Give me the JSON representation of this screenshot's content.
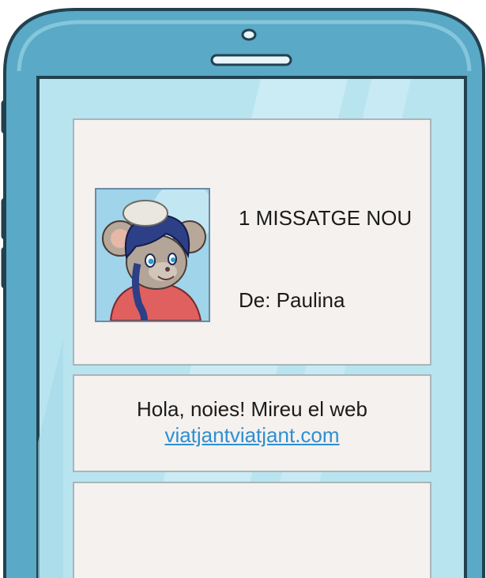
{
  "notification": {
    "title": "1 MISSATGE NOU",
    "sender": "De: Paulina",
    "avatar_icon": "mouse-girl-avatar"
  },
  "message": {
    "text": "Hola, noies! Mireu el web",
    "link": "viatjantviatjant.com"
  },
  "colors": {
    "phone_body": "#5aa9c6",
    "phone_outline": "#22414f",
    "screen_bg": "#b7e4ef",
    "panel_bg": "#f4f1ef",
    "link": "#2e8fd0"
  }
}
